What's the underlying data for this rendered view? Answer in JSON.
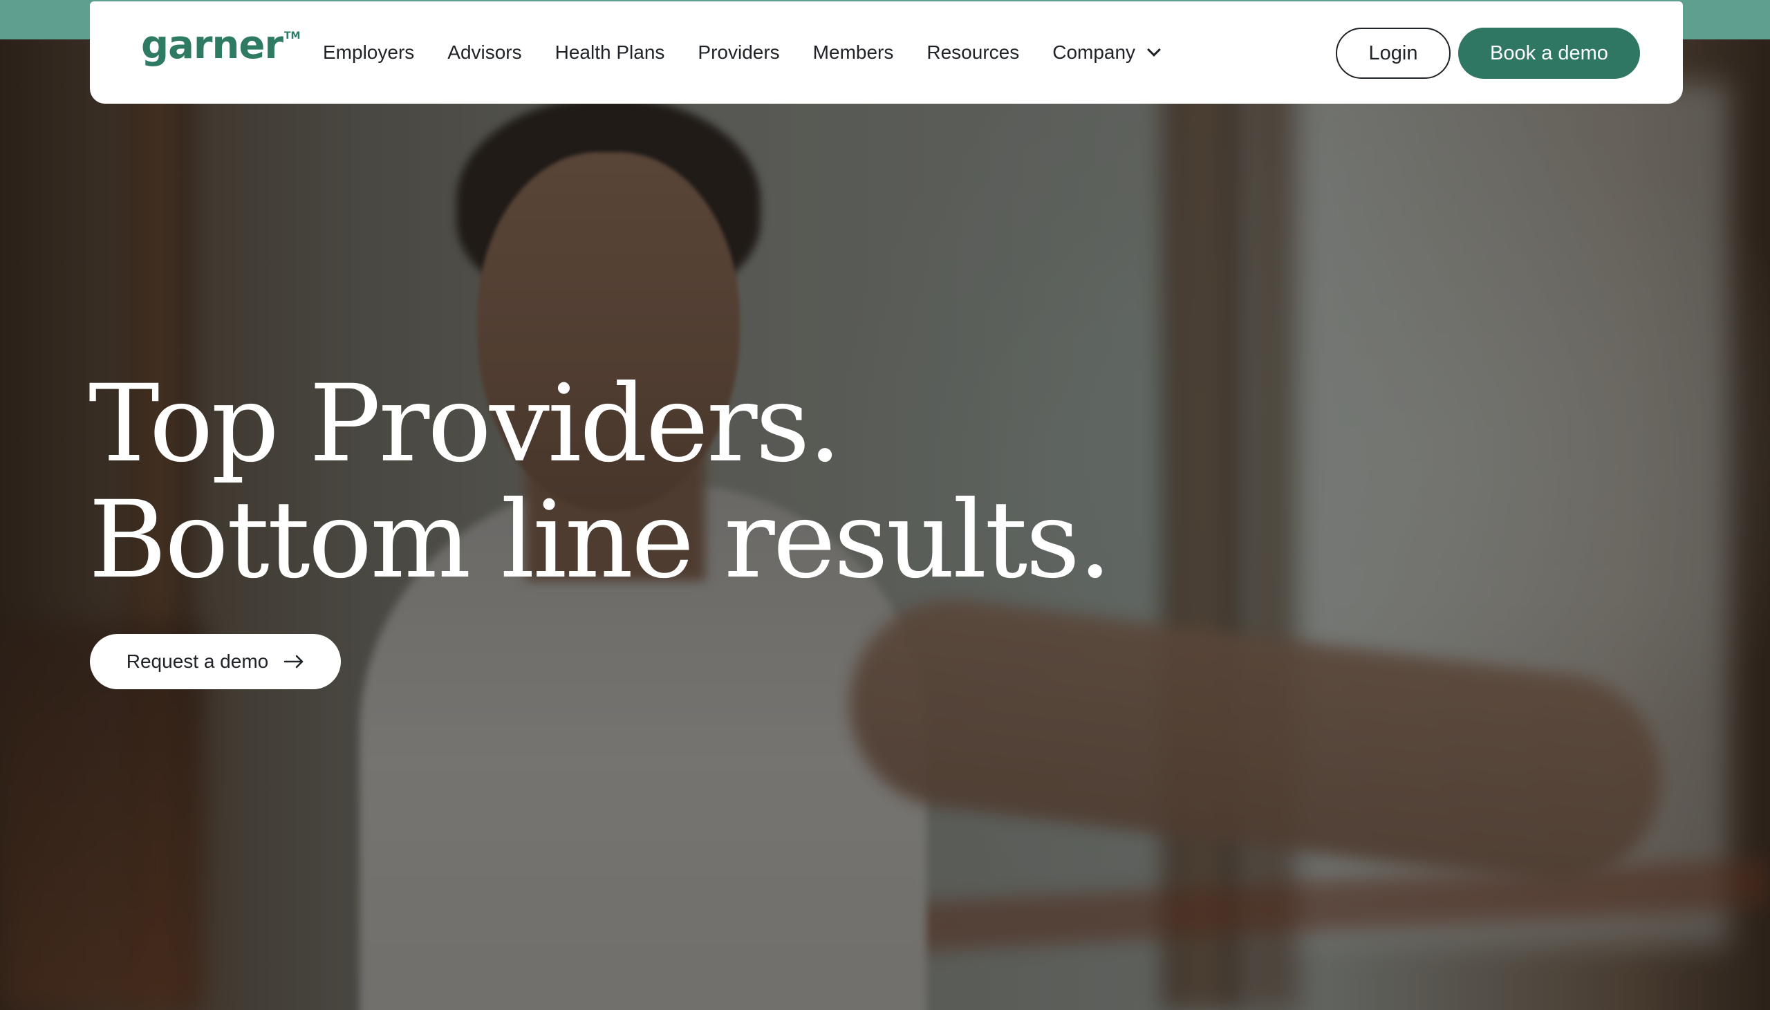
{
  "brand": {
    "logo_text": "garner",
    "logo_tm": "TM",
    "color_primary": "#307763",
    "color_strip": "#5f9f8f"
  },
  "nav": {
    "links": [
      {
        "label": "Employers"
      },
      {
        "label": "Advisors"
      },
      {
        "label": "Health Plans"
      },
      {
        "label": "Providers"
      },
      {
        "label": "Members"
      },
      {
        "label": "Resources"
      },
      {
        "label": "Company",
        "has_dropdown": true
      }
    ],
    "login_label": "Login",
    "book_demo_label": "Book a demo"
  },
  "hero": {
    "headline_line1": "Top Providers.",
    "headline_line2": "Bottom line results.",
    "cta_label": "Request a demo",
    "cta_icon": "arrow-right-icon",
    "background": "blurred photo of a man stretching his arm indoors"
  }
}
